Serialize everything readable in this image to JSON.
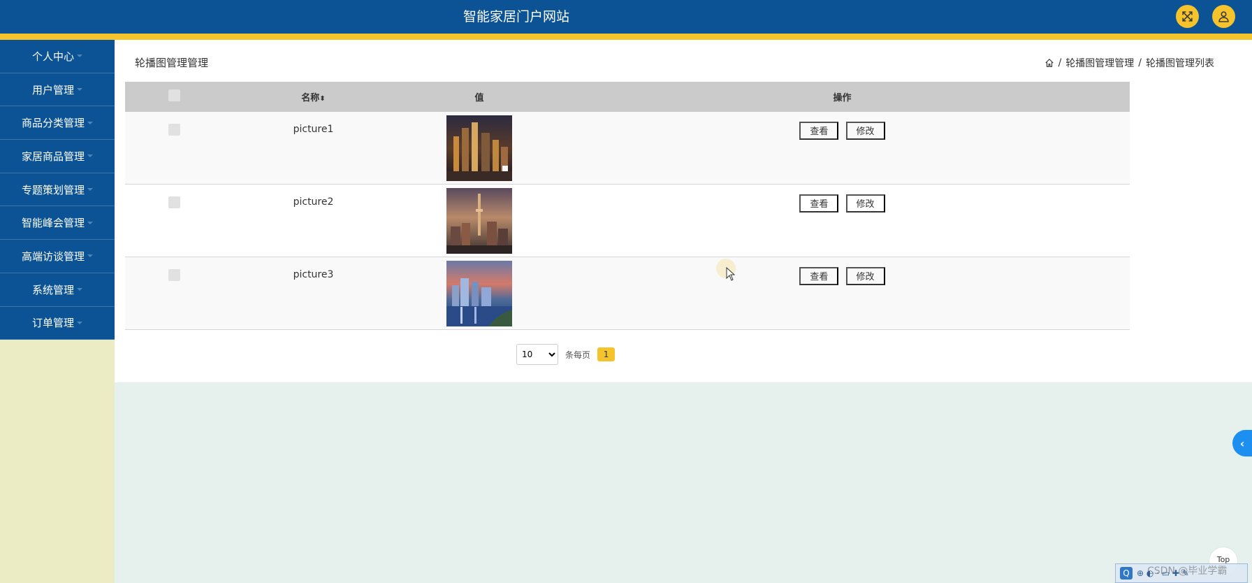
{
  "header": {
    "title": "智能家居门户网站",
    "fullscreen_icon": "fullscreen-icon",
    "user_icon": "user-icon",
    "colors": {
      "header_bg": "#0b5394",
      "accent": "#f5c42c"
    }
  },
  "sidebar": {
    "items": [
      {
        "label": "个人中心"
      },
      {
        "label": "用户管理"
      },
      {
        "label": "商品分类管理"
      },
      {
        "label": "家居商品管理"
      },
      {
        "label": "专题策划管理"
      },
      {
        "label": "智能峰会管理"
      },
      {
        "label": "高端访谈管理"
      },
      {
        "label": "系统管理"
      },
      {
        "label": "订单管理"
      }
    ]
  },
  "main": {
    "page_title": "轮播图管理管理",
    "breadcrumb": {
      "level1": "轮播图管理管理",
      "level2": "轮播图管理列表",
      "separator": "/"
    },
    "table": {
      "headers": {
        "name": "名称",
        "value": "值",
        "actions": "操作"
      },
      "rows": [
        {
          "name": "picture1",
          "view": "查看",
          "edit": "修改"
        },
        {
          "name": "picture2",
          "view": "查看",
          "edit": "修改"
        },
        {
          "name": "picture3",
          "view": "查看",
          "edit": "修改"
        }
      ]
    },
    "pagination": {
      "page_size": "10",
      "page_size_options": [
        "10"
      ],
      "per_page_label": "条每页",
      "current_page": "1"
    }
  },
  "floating": {
    "collapse_label": "‹",
    "top_label": "Top"
  },
  "watermark": "CSDN @毕业学霸"
}
